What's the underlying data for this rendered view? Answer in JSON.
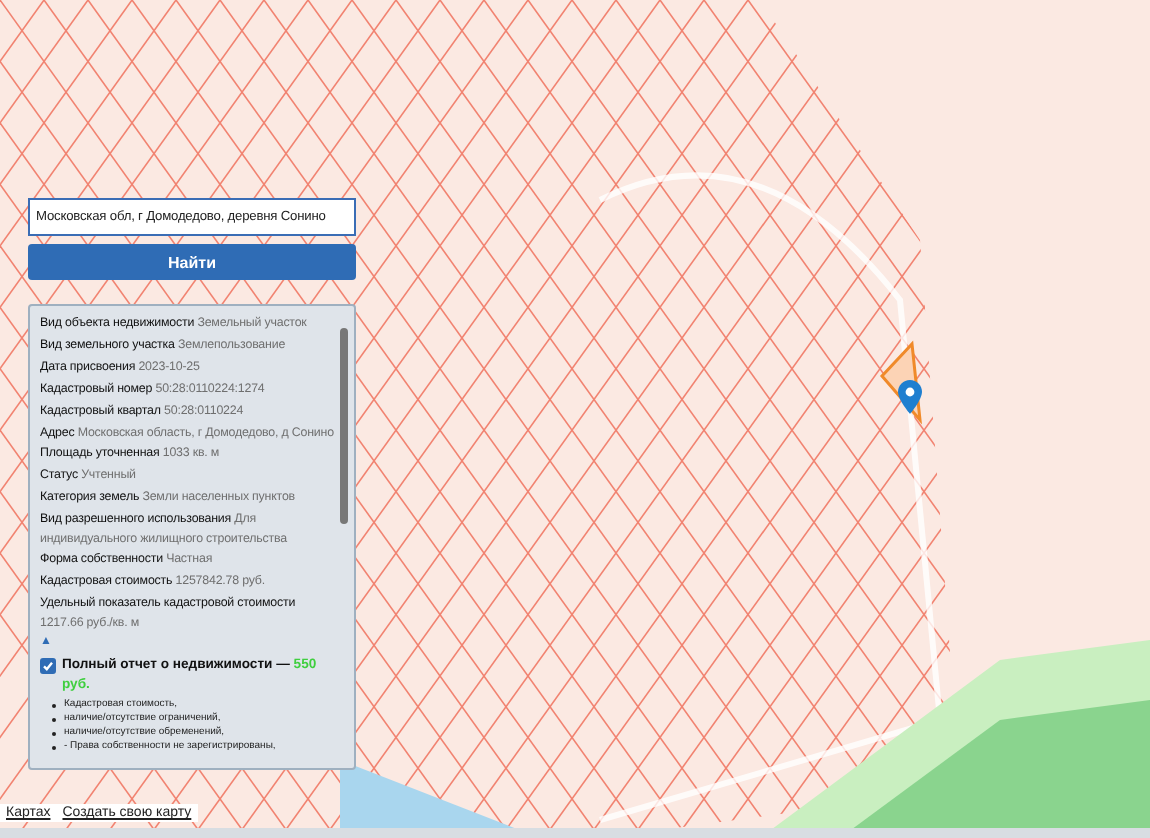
{
  "search": {
    "value": "Московская обл, г Домодедово, деревня Сонино"
  },
  "search_button": "Найти",
  "info": [
    {
      "label": "Вид объекта недвижимости",
      "value": "Земельный участок"
    },
    {
      "label": "Вид земельного участка",
      "value": "Землепользование"
    },
    {
      "label": "Дата присвоения",
      "value": "2023-10-25"
    },
    {
      "label": "Кадастровый номер",
      "value": "50:28:0110224:1274"
    },
    {
      "label": "Кадастровый квартал",
      "value": "50:28:0110224"
    },
    {
      "label": "Адрес",
      "value": "Московская область, г Домодедово, д Сонино"
    },
    {
      "label": "Площадь уточненная",
      "value": "1033 кв. м"
    },
    {
      "label": "Статус",
      "value": "Учтенный"
    },
    {
      "label": "Категория земель",
      "value": "Земли населенных пунктов"
    },
    {
      "label": "Вид разрешенного использования",
      "value": "Для индивидуального жилищного строительства"
    },
    {
      "label": "Форма собственности",
      "value": "Частная"
    },
    {
      "label": "Кадастровая стоимость",
      "value": "1257842.78 руб."
    },
    {
      "label": "Удельный показатель кадастровой стоимости",
      "value": "1217.66 руб./кв. м"
    }
  ],
  "collapse_toggle": "▲",
  "report": {
    "checked": true,
    "title": "Полный отчет о недвижимости —",
    "price": "550 руб.",
    "items": [
      "Кадастровая стоимость,",
      "наличие/отсутствие ограничений,",
      "наличие/отсутствие обременений,",
      "- Права собственности не зарегистрированы,"
    ]
  },
  "footer_links": [
    "Картах",
    "Создать свою карту"
  ]
}
